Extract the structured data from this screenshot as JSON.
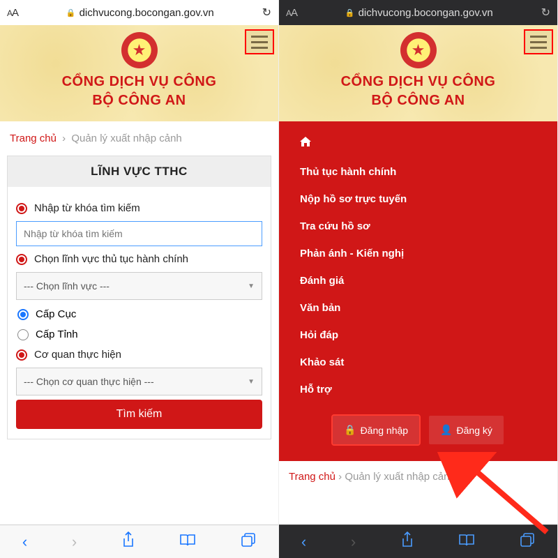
{
  "url": "dichvucong.bocongan.gov.vn",
  "banner": {
    "title_line1": "CỔNG DỊCH VỤ CÔNG",
    "title_line2": "BỘ CÔNG AN"
  },
  "breadcrumb": {
    "home": "Trang chủ",
    "current": "Quản lý xuất nhập cảnh"
  },
  "panel": {
    "title": "LĨNH VỰC TTHC",
    "keyword_label": "Nhập từ khóa tìm kiếm",
    "keyword_placeholder": "Nhập từ khóa tìm kiếm",
    "field_label": "Chọn lĩnh vực thủ tục hành chính",
    "field_select": "--- Chọn lĩnh vực ---",
    "level1": "Cấp Cục",
    "level2": "Cấp Tỉnh",
    "agency_label": "Cơ quan thực hiện",
    "agency_select": "--- Chọn cơ quan thực hiện ---",
    "search_btn": "Tìm kiếm"
  },
  "menu": {
    "items": [
      "Thủ tục hành chính",
      "Nộp hồ sơ trực tuyến",
      "Tra cứu hồ sơ",
      "Phản ánh - Kiến nghị",
      "Đánh giá",
      "Văn bản",
      "Hỏi đáp",
      "Khảo sát",
      "Hỗ trợ"
    ],
    "login": "Đăng nhập",
    "register": "Đăng ký"
  }
}
